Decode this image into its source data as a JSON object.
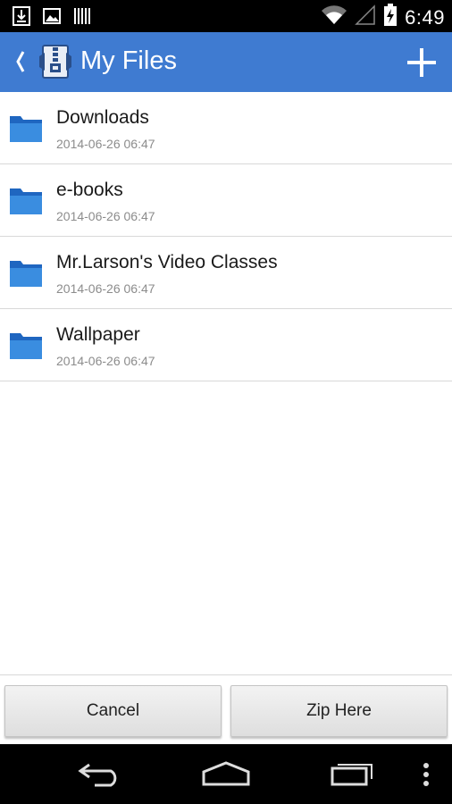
{
  "status_bar": {
    "time": "6:49",
    "icons": [
      "download-icon",
      "image-icon",
      "barcode-icon",
      "wifi-icon",
      "signal-icon",
      "battery-charging-icon"
    ]
  },
  "app_bar": {
    "title": "My Files",
    "accent_color": "#3f7bd1"
  },
  "files": [
    {
      "name": "Downloads",
      "date": "2014-06-26 06:47"
    },
    {
      "name": "e-books",
      "date": "2014-06-26 06:47"
    },
    {
      "name": "Mr.Larson's Video Classes",
      "date": "2014-06-26 06:47"
    },
    {
      "name": "Wallpaper",
      "date": "2014-06-26 06:47"
    }
  ],
  "buttons": {
    "cancel_label": "Cancel",
    "zip_label": "Zip Here"
  }
}
